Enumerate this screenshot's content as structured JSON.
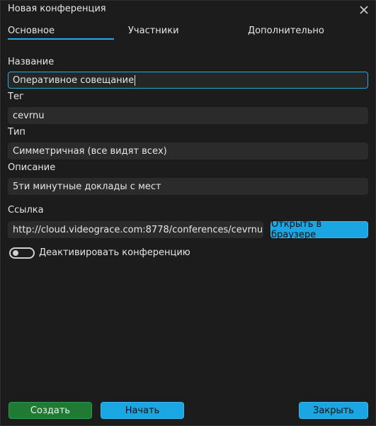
{
  "window": {
    "title": "Новая конференция"
  },
  "tabs": [
    {
      "label": "Основное"
    },
    {
      "label": "Участники"
    },
    {
      "label": "Дополнительно"
    }
  ],
  "form": {
    "name": {
      "label": "Название",
      "value": "Оперативное совещание"
    },
    "tag": {
      "label": "Тег",
      "value": "cevrnu"
    },
    "type": {
      "label": "Тип",
      "value": "Симметричная (все видят всех)"
    },
    "description": {
      "label": "Описание",
      "value": "5ти минутные доклады с мест"
    },
    "link": {
      "label": "Ссылка",
      "value": "http://cloud.videograce.com:8778/conferences/cevrnu"
    }
  },
  "buttons": {
    "open_in_browser": "Открыть в браузере",
    "create": "Создать",
    "start": "Начать",
    "close": "Закрыть"
  },
  "deactivate": {
    "label": "Деактивировать конференцию",
    "checked": false
  },
  "colors": {
    "accent": "#1aa5e3",
    "create_button": "#1f7a34",
    "background": "#1c1c1c",
    "field_background": "#2b2b2b"
  },
  "icons": {
    "close": "close-icon"
  }
}
